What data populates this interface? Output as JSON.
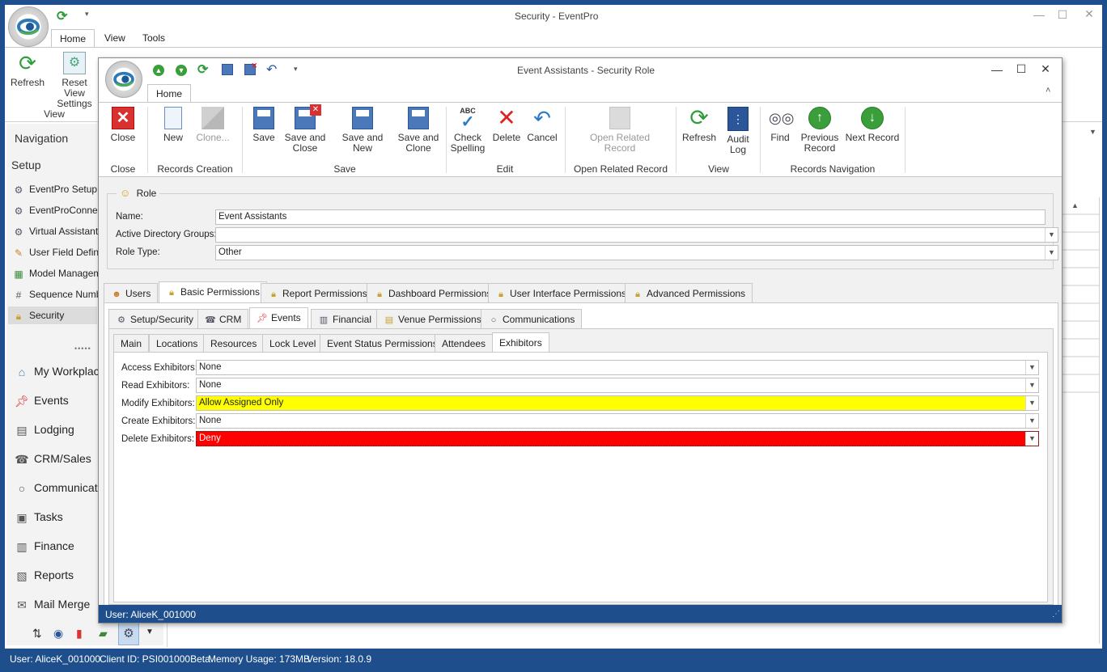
{
  "outer": {
    "title": "Security - EventPro",
    "tabs": [
      "Home",
      "View",
      "Tools"
    ],
    "ribbon": {
      "refresh": "Refresh",
      "reset_view_line1": "Reset View",
      "reset_view_line2": "Settings",
      "group_view": "View"
    },
    "nav": {
      "header": "Navigation",
      "section": "Setup",
      "items": [
        {
          "label": "EventPro Setup",
          "icon": "gear-icon"
        },
        {
          "label": "EventProConnect",
          "icon": "gear-icon"
        },
        {
          "label": "Virtual Assistant S",
          "icon": "gear-icon"
        },
        {
          "label": "User Field Definiti",
          "icon": "user-field-icon"
        },
        {
          "label": "Model Manageme",
          "icon": "model-icon"
        },
        {
          "label": "Sequence Numbe",
          "icon": "hash-icon"
        },
        {
          "label": "Security",
          "icon": "lock-icon"
        }
      ],
      "modules": [
        {
          "label": "My Workplac",
          "icon": "home-icon"
        },
        {
          "label": "Events",
          "icon": "pin-icon"
        },
        {
          "label": "Lodging",
          "icon": "lodging-icon"
        },
        {
          "label": "CRM/Sales",
          "icon": "crm-icon"
        },
        {
          "label": "Communicati",
          "icon": "chat-icon"
        },
        {
          "label": "Tasks",
          "icon": "tasks-icon"
        },
        {
          "label": "Finance",
          "icon": "finance-icon"
        },
        {
          "label": "Reports",
          "icon": "reports-icon"
        },
        {
          "label": "Mail Merge",
          "icon": "mail-merge-icon"
        }
      ]
    },
    "statusbar": {
      "user": "User: AliceK_001000",
      "client": "Client ID: PSI001000Beta",
      "memory": "Memory Usage: 173MB",
      "version": "Version: 18.0.9"
    }
  },
  "dialog": {
    "title": "Event Assistants - Security Role",
    "tab": "Home",
    "ribbon": {
      "close": "Close",
      "new": "New",
      "clone": "Clone...",
      "save": "Save",
      "save_close_1": "Save and",
      "save_close_2": "Close",
      "save_new": "Save and New",
      "save_clone_1": "Save and",
      "save_clone_2": "Clone",
      "check_1": "Check",
      "check_2": "Spelling",
      "delete": "Delete",
      "cancel": "Cancel",
      "open_related_1": "Open Related",
      "open_related_2": "Record",
      "refresh": "Refresh",
      "audit_1": "Audit",
      "audit_2": "Log",
      "find": "Find",
      "prev_1": "Previous",
      "prev_2": "Record",
      "next": "Next Record",
      "groups": {
        "close": "Close",
        "records_creation": "Records Creation",
        "save": "Save",
        "edit": "Edit",
        "open_related": "Open Related Record",
        "view": "View",
        "records_nav": "Records Navigation"
      }
    },
    "role": {
      "header": "Role",
      "name_label": "Name:",
      "name_value": "Event Assistants",
      "ad_label": "Active Directory Groups:",
      "ad_value": "",
      "type_label": "Role Type:",
      "type_value": "Other"
    },
    "perm_tabs": [
      "Users",
      "Basic Permissions",
      "Report Permissions",
      "Dashboard Permissions",
      "User Interface Permissions",
      "Advanced Permissions"
    ],
    "sub_tabs": [
      "Setup/Security",
      "CRM",
      "Events",
      "Financial",
      "Venue Permissions",
      "Communications"
    ],
    "event_tabs": [
      "Main",
      "Locations",
      "Resources",
      "Lock Level",
      "Event Status Permissions",
      "Attendees",
      "Exhibitors"
    ],
    "exhibitors": [
      {
        "label": "Access Exhibitors:",
        "value": "None",
        "color": "#ffffff"
      },
      {
        "label": "Read Exhibitors:",
        "value": "None",
        "color": "#ffffff"
      },
      {
        "label": "Modify Exhibitors:",
        "value": "Allow Assigned Only",
        "color": "#ffff00"
      },
      {
        "label": "Create Exhibitors:",
        "value": "None",
        "color": "#ffffff"
      },
      {
        "label": "Delete Exhibitors:",
        "value": "Deny",
        "color": "#ff0000"
      }
    ],
    "status_user": "User: AliceK_001000"
  },
  "colors": {
    "statusbar": "#1e4f8c",
    "accent": "#2b579a"
  }
}
